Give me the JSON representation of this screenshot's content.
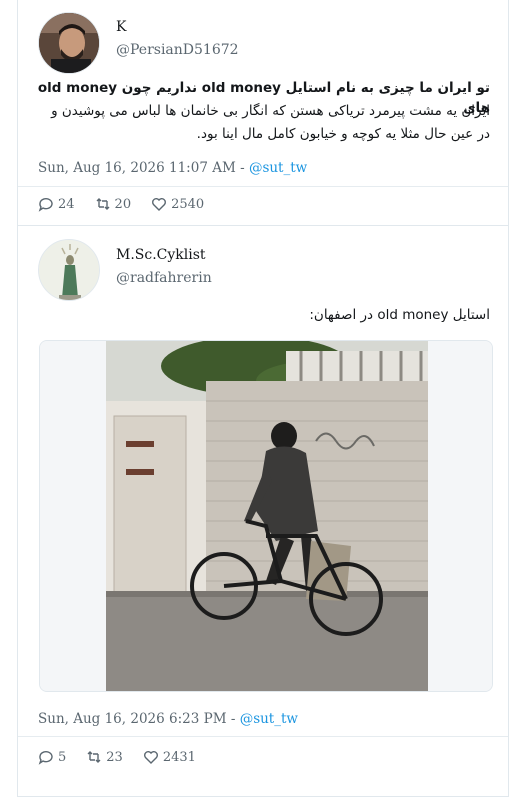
{
  "tweets": [
    {
      "name": "K",
      "handle": "@PersianD51672",
      "text_line1": "تو ایران ما چیزی به نام استایل old money نداریم چون old money های",
      "text_line2": "ایران یه مشت پیرمرد تریاکی هستن که انگار بی خانمان ها لباس می پوشیدن و",
      "text_line3": "در عین حال مثلا یه کوچه و خیابون کامل مال اینا بود.",
      "timestamp": "Sun, Aug 16, 2026 11:07 AM",
      "sep": " - ",
      "via": "@sut_tw",
      "replies": "24",
      "retweets": "20",
      "likes": "2540",
      "avatar_icon": "person-avatar"
    },
    {
      "name": "M.Sc.Cyklist",
      "handle": "@radfahrerin",
      "text_line1": "استایل old money در اصفهان:",
      "timestamp": "Sun, Aug 16, 2026 6:23 PM",
      "sep": " - ",
      "via": "@sut_tw",
      "replies": "5",
      "retweets": "23",
      "likes": "2431",
      "avatar_icon": "statue-avatar",
      "media_alt": "photo of an old man riding a bicycle past a wall"
    }
  ],
  "colors": {
    "text": "#14171a",
    "muted": "#5b6770",
    "link": "#1b95e0",
    "border": "#e1e8ed"
  }
}
